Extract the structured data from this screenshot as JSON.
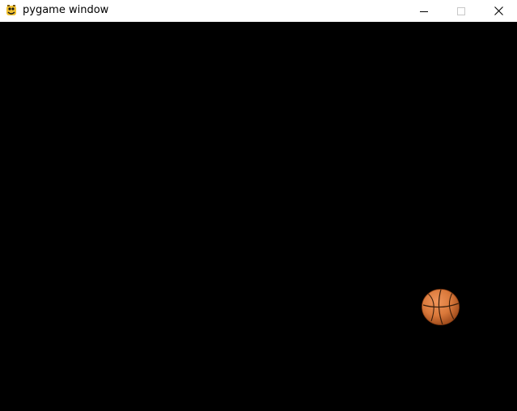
{
  "window": {
    "title": "pygame window",
    "controls": {
      "minimize_icon": "minimize-icon",
      "maximize_icon": "maximize-icon",
      "close_icon": "close-icon"
    }
  },
  "game": {
    "background_color": "#000000",
    "sprite": "basketball",
    "ball_color": "#d9783a"
  }
}
